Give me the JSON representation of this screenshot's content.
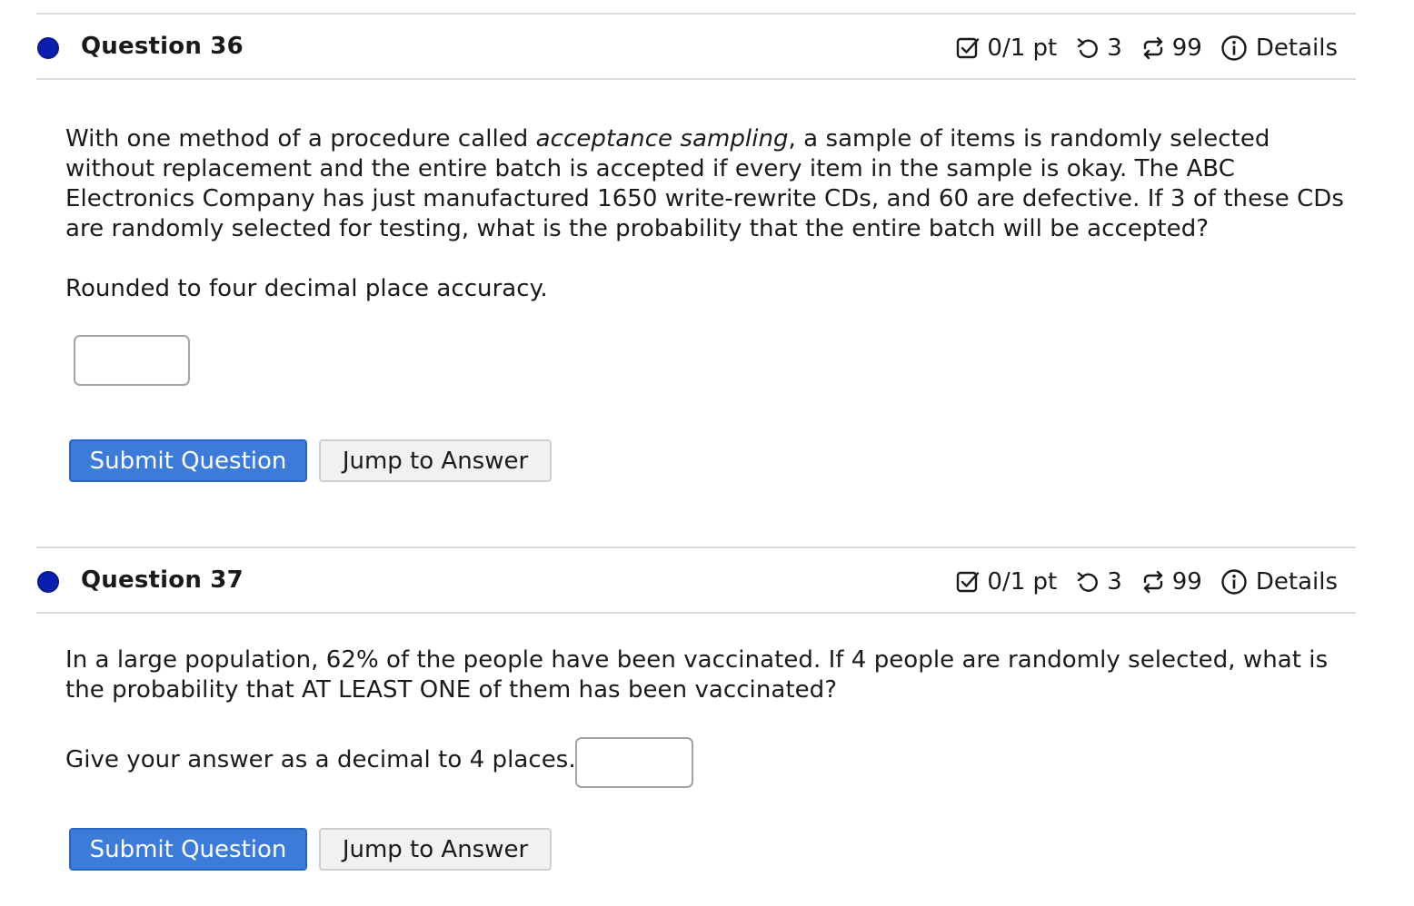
{
  "questions": [
    {
      "title": "Question 36",
      "score": "0/1 pt",
      "attempts": "3",
      "retries": "99",
      "details_label": "Details",
      "text_part1": "With one method of a procedure called ",
      "text_emphasis": "acceptance sampling",
      "text_part2": ", a sample of items is randomly selected without replacement and the entire batch is accepted if every item in the sample is okay. The ABC Electronics Company has just manufactured 1650 write-rewrite CDs, and 60 are defective. If 3 of these CDs are randomly selected for testing, what is the probability that the entire batch will be accepted?",
      "instruction": "Rounded to four decimal place accuracy.",
      "answer_value": "",
      "submit_label": "Submit Question",
      "jump_label": "Jump to Answer"
    },
    {
      "title": "Question 37",
      "score": "0/1 pt",
      "attempts": "3",
      "retries": "99",
      "details_label": "Details",
      "text": "In a large population, 62% of the people have been vaccinated. If 4 people are randomly selected, what is the probability that AT LEAST ONE of them has been vaccinated?",
      "instruction": "Give your answer as a decimal to 4 places.",
      "answer_value": "",
      "submit_label": "Submit Question",
      "jump_label": "Jump to Answer"
    }
  ],
  "icons": {
    "status_dot": "status-dot-icon",
    "score": "checkbox-icon",
    "attempts": "undo-arrow-icon",
    "retries": "repeat-arrows-icon",
    "details": "info-icon"
  },
  "colors": {
    "status_dot": "#0a1fb0",
    "primary_button": "#3d7bd9",
    "secondary_button": "#f1f1f1",
    "divider": "#d9d9d9"
  }
}
